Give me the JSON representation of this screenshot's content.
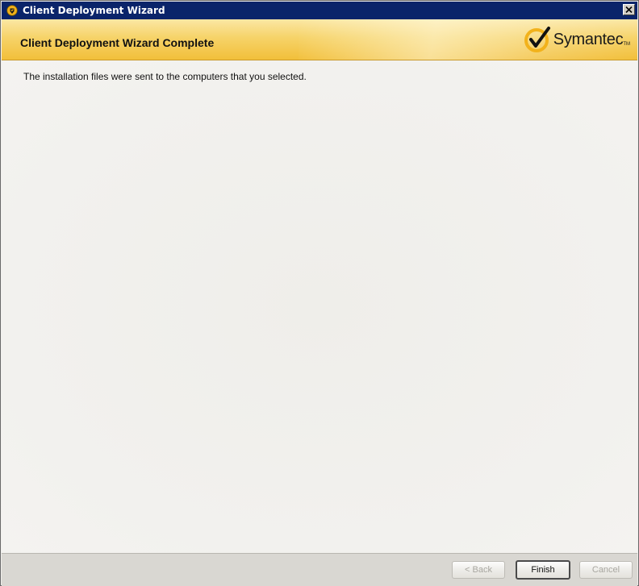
{
  "window": {
    "title": "Client Deployment Wizard"
  },
  "header": {
    "title": "Client Deployment Wizard Complete",
    "logo_text": "Symantec",
    "logo_tm": "TM"
  },
  "content": {
    "message": "The installation files were sent to the computers that you selected."
  },
  "footer": {
    "back_label": "< Back",
    "finish_label": "Finish",
    "cancel_label": "Cancel"
  },
  "colors": {
    "titlebar": "#0a246a",
    "banner_accent": "#f2bf3a",
    "logo_check": "#f2b21b"
  },
  "icons": {
    "window": "symantec-shield-icon",
    "close": "close-icon",
    "logo": "symantec-checkmark-icon"
  }
}
